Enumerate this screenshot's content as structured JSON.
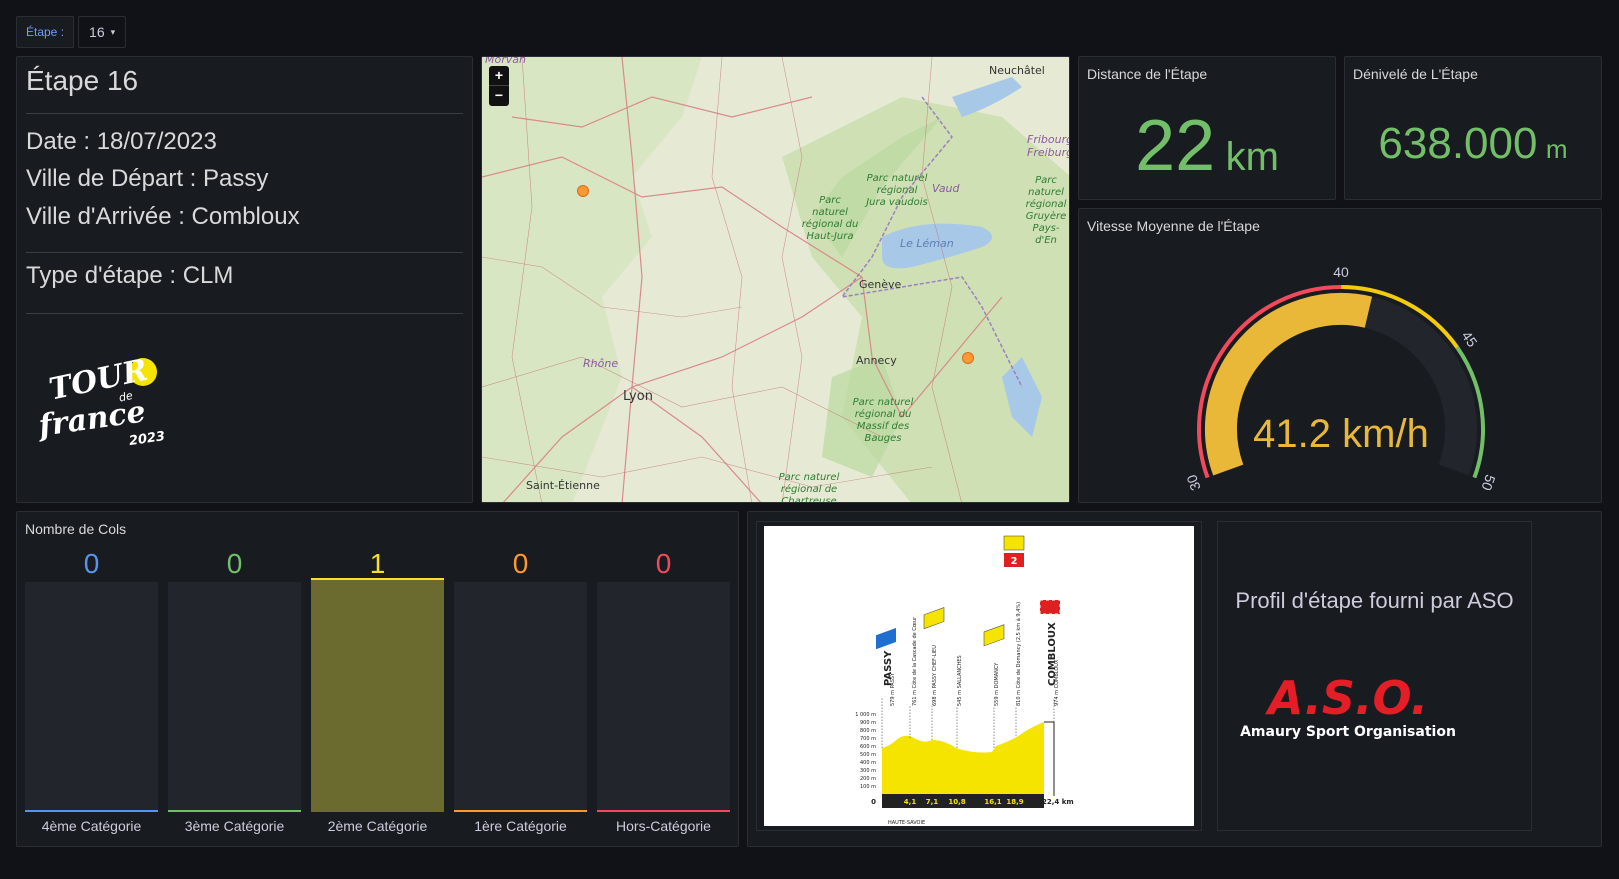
{
  "variable": {
    "label": "Étape :",
    "value": "16"
  },
  "info": {
    "title": "Étape 16",
    "date": "Date : 18/07/2023",
    "depart": "Ville de Départ : Passy",
    "arrivee": "Ville d'Arrivée : Combloux",
    "type": "Type d'étape : CLM",
    "logo_text": "TOUR de France 2023"
  },
  "map": {
    "labels": [
      "Morvan",
      "Neuchâtel",
      "Fribourg",
      "Freiburg",
      "Vaud",
      "Parc naturel régional Jura vaudois",
      "Parc naturel régional du Haut-Jura",
      "Le Léman",
      "Genève",
      "Rhône",
      "Lyon",
      "Annecy",
      "Parc naturel régional du Massif des Bauges",
      "Saint-Étienne",
      "Parc naturel régional de Chartreuse",
      "Parc naturel régional Gruyère Pays-d'En"
    ],
    "zoom_in": "+",
    "zoom_out": "−"
  },
  "distance": {
    "title": "Distance de l'Étape",
    "value": "22",
    "unit": "km"
  },
  "denivele": {
    "title": "Dénivelé de L'Étape",
    "value": "638.000",
    "unit": "m"
  },
  "speed": {
    "title": "Vitesse Moyenne de l'Étape",
    "value": 41.2,
    "display": "41.2 km/h",
    "min": 30,
    "max": 50,
    "ticks": [
      "30",
      "40",
      "45",
      "50"
    ],
    "colors": {
      "red": "#f2495c",
      "yellow": "#f2cc0c",
      "gauge": "#eab839",
      "green": "#73bf69",
      "track": "#22252b"
    }
  },
  "cols": {
    "title": "Nombre de Cols",
    "bars": [
      {
        "label": "4ème Catégorie",
        "value": "0",
        "color": "#5794f2"
      },
      {
        "label": "3ème Catégorie",
        "value": "0",
        "color": "#73bf69"
      },
      {
        "label": "2ème Catégorie",
        "value": "1",
        "color": "#fade2a"
      },
      {
        "label": "1ère Catégorie",
        "value": "0",
        "color": "#ff9830"
      },
      {
        "label": "Hors-Catégorie",
        "value": "0",
        "color": "#f2495c"
      }
    ]
  },
  "profile": {
    "aso_text": "Profil d'étape fourni par ASO",
    "aso_logo": "A.S.O.",
    "aso_tagline": "Amaury Sport Organisation",
    "start_town": "PASSY",
    "finish_town": "COMBLOUX",
    "points": [
      "579 m PASSY",
      "761 m Côte de la Cascade de Cœur",
      "698 m PASSY CHEF-LIEU",
      "545 m SALLANCHES",
      "559 m DOMANCY",
      "810 m Côte de Domancy (2,5 km à 9,4%)",
      "974 m COMBLOUX"
    ],
    "km_marks": [
      "0",
      "4,1",
      "7,1",
      "10,8",
      "16,1",
      "18,9",
      "22,4 km"
    ],
    "alt_ticks": [
      "1 000 m",
      "900 m",
      "800 m",
      "700 m",
      "600 m",
      "500 m",
      "400 m",
      "300 m",
      "200 m",
      "100 m"
    ],
    "region": "HAUTE-SAVOIE",
    "cat_badge": "2"
  }
}
